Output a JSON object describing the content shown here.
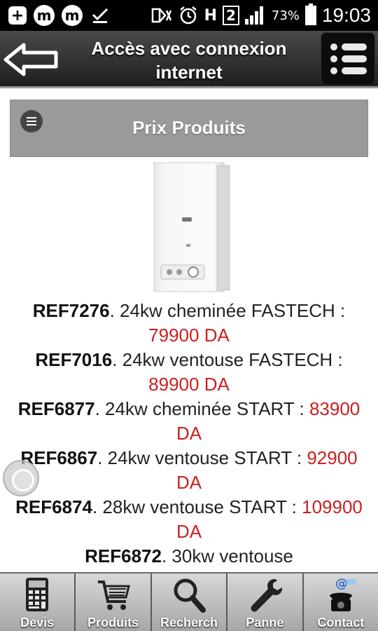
{
  "status_bar": {
    "battery": "73%",
    "sim_slot": "2",
    "network": "H",
    "time": "19:03"
  },
  "header": {
    "title": "Accès avec connexion internet",
    "back_icon": "back-arrow-icon",
    "menu_icon": "list-menu-icon"
  },
  "section": {
    "title": "Prix Produits"
  },
  "products": [
    {
      "ref": "REF7276",
      "desc": ". 24kw cheminée FASTECH : ",
      "price": "79900 DA"
    },
    {
      "ref": "REF7016",
      "desc": ". 24kw ventouse FASTECH : ",
      "price": "89900 DA"
    },
    {
      "ref": "REF6877",
      "desc": ". 24kw cheminée START : ",
      "price": "83900 DA"
    },
    {
      "ref": "REF6867",
      "desc": ". 24kw ventouse START : ",
      "price": "92900 DA"
    },
    {
      "ref": "REF6874",
      "desc": ". 28kw ventouse START : ",
      "price": "109900 DA"
    },
    {
      "ref": "REF6872",
      "desc": ". 30kw ventouse",
      "price": ""
    }
  ],
  "bottom_nav": [
    {
      "label": "Devis",
      "icon": "calculator-icon"
    },
    {
      "label": "Produits",
      "icon": "cart-icon"
    },
    {
      "label": "Recherch",
      "icon": "magnifier-icon"
    },
    {
      "label": "Panne",
      "icon": "wrench-icon"
    },
    {
      "label": "Contact",
      "icon": "phone-email-icon"
    }
  ],
  "colors": {
    "price": "#cc1f1f",
    "header_bar": "#9a9a9a",
    "title_bar": "#2a2a2a"
  }
}
